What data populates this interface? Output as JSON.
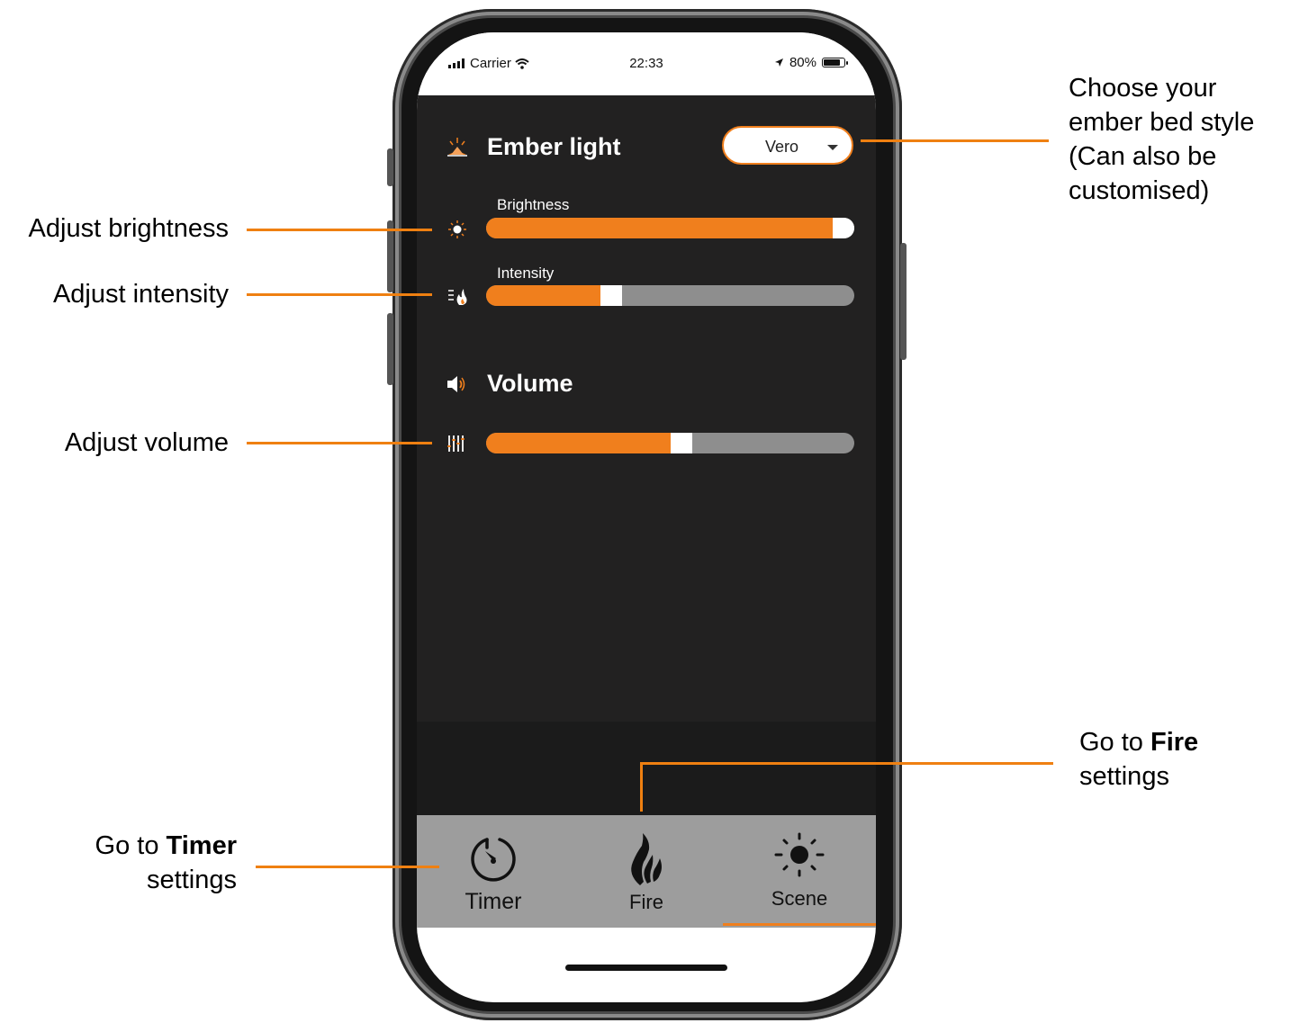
{
  "status_bar": {
    "carrier": "Carrier",
    "time": "22:33",
    "battery": "80%",
    "battery_level": 0.8
  },
  "ember_section": {
    "title": "Ember light",
    "style_dropdown": {
      "selected": "Vero"
    },
    "brightness": {
      "label": "Brightness",
      "value_fraction": 0.97
    },
    "intensity": {
      "label": "Intensity",
      "value_fraction": 0.31
    }
  },
  "volume_section": {
    "title": "Volume",
    "volume": {
      "value_fraction": 0.5
    }
  },
  "tabbar": {
    "tabs": [
      {
        "label": "Timer",
        "icon": "timer-icon"
      },
      {
        "label": "Fire",
        "icon": "flame-icon"
      },
      {
        "label": "Scene",
        "icon": "sun-icon",
        "active": true
      }
    ]
  },
  "callouts": {
    "ember_style": [
      "Choose your",
      "ember bed style",
      "(Can also be",
      "customised)"
    ],
    "brightness": "Adjust brightness",
    "intensity": "Adjust intensity",
    "volume": "Adjust volume",
    "fire": {
      "prefix": "Go to ",
      "bold": "Fire",
      "suffix": "settings"
    },
    "timer": {
      "prefix": "Go to ",
      "bold": "Timer",
      "suffix": "settings"
    }
  },
  "colors": {
    "accent": "#f07f1d",
    "app_background": "#222121",
    "tabbar": "#9d9d9d"
  }
}
